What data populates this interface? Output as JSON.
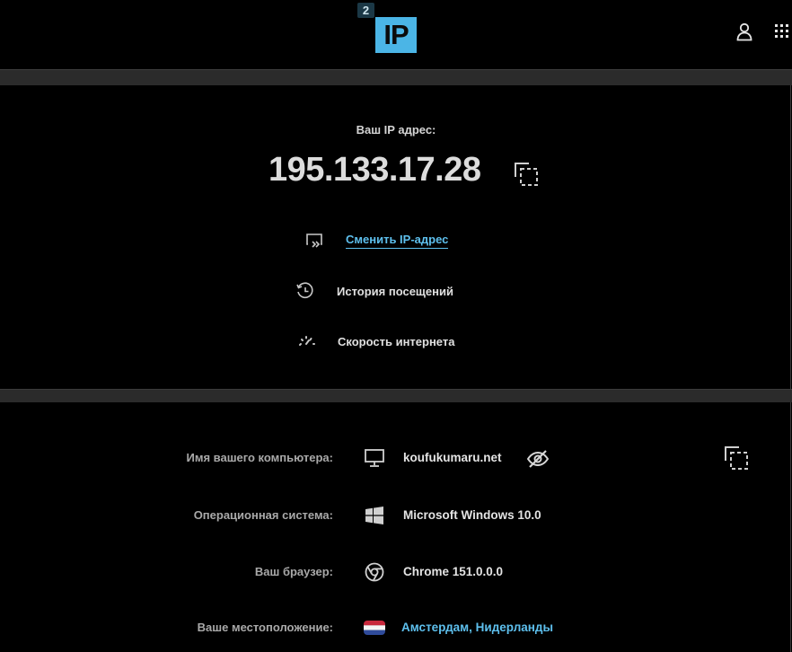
{
  "logo": {
    "badge": "2",
    "text": "IP"
  },
  "header": {
    "user_icon": "user-icon",
    "apps_icon": "apps-grid-icon"
  },
  "ip_block": {
    "caption": "Ваш IP адрес:",
    "address": "195.133.17.28",
    "copy_icon": "copy-icon"
  },
  "actions": [
    {
      "label": "Сменить IP-адрес",
      "icon": "change-ip-icon",
      "color": "#5ec0ee"
    },
    {
      "label": "История посещений",
      "icon": "history-icon"
    },
    {
      "label": "Скорость интернета",
      "icon": "speedometer-icon"
    }
  ],
  "info": [
    {
      "key": "Имя вашего компьютера:",
      "value": "koufukumaru.net",
      "icon": "monitor-icon"
    },
    {
      "key": "Операционная система:",
      "value": "Microsoft Windows 10.0",
      "icon": "windows-icon"
    },
    {
      "key": "Ваш браузер:",
      "value": "Chrome 151.0.0.0",
      "icon": "chrome-icon"
    },
    {
      "key": "Ваше местоположение:",
      "value": "Амстердам, Нидерланды",
      "icon": "netherlands-flag-icon"
    }
  ],
  "colors": {
    "accent": "#4bb5e6",
    "link": "#5ec0ee",
    "background": "#000000",
    "divider": "#2b2b2b"
  }
}
